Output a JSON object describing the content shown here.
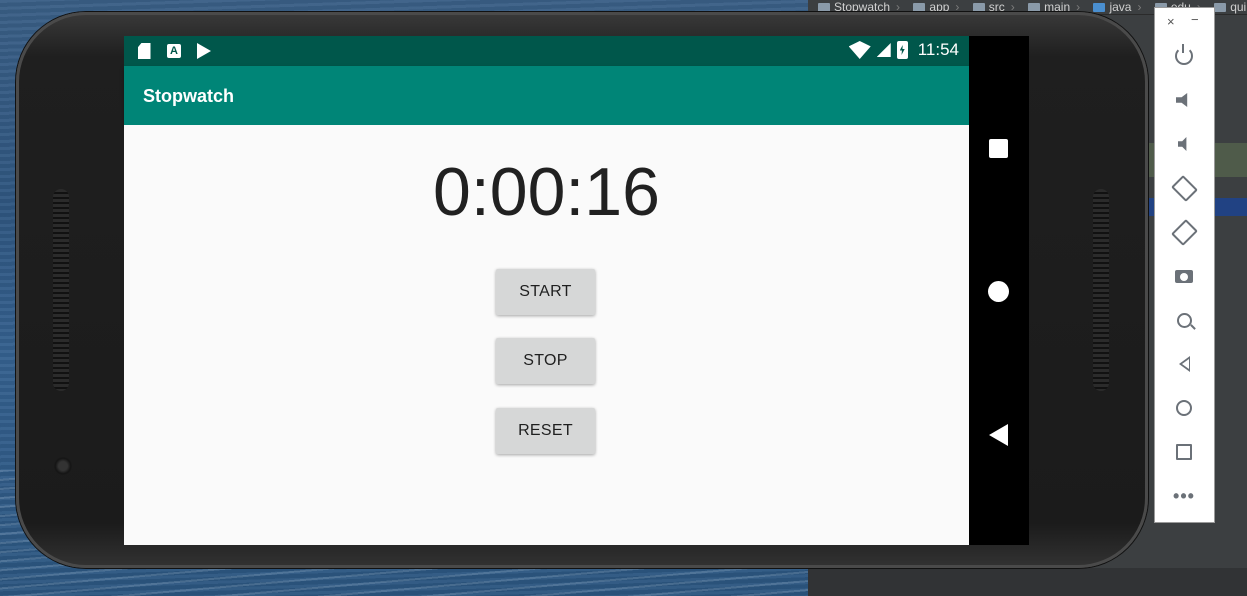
{
  "ide": {
    "breadcrumbs": [
      "Stopwatch",
      "app",
      "src",
      "main",
      "java",
      "edu",
      "quinnip"
    ]
  },
  "status_bar": {
    "time": "11:54",
    "icons": [
      "sd-card-icon",
      "a-notification-icon",
      "play-store-icon",
      "wifi-icon",
      "signal-icon",
      "battery-charging-icon"
    ]
  },
  "app_bar": {
    "title": "Stopwatch"
  },
  "main": {
    "timer": "0:00:16",
    "buttons": {
      "start": "START",
      "stop": "STOP",
      "reset": "RESET"
    }
  },
  "nav_bar": {
    "icons": [
      "recents-icon",
      "home-icon",
      "back-icon"
    ]
  },
  "emulator_toolbar": {
    "close": "×",
    "minimize": "−",
    "more": "•••",
    "icons": [
      "power-icon",
      "volume-up-icon",
      "volume-down-icon",
      "rotate-left-icon",
      "rotate-right-icon",
      "camera-icon",
      "zoom-icon",
      "back-icon",
      "home-icon",
      "overview-icon",
      "more-icon"
    ]
  }
}
